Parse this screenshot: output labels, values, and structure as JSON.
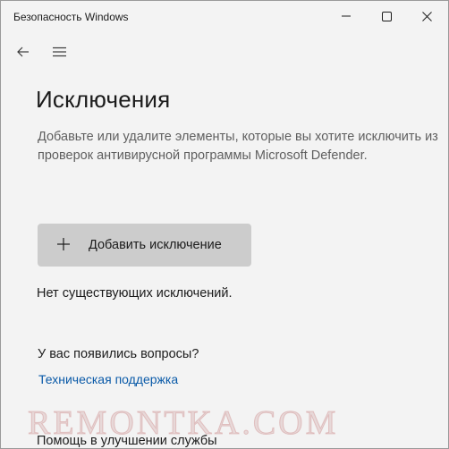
{
  "window": {
    "title": "Безопасность Windows"
  },
  "controls": {
    "minimize_icon": "minimize-icon",
    "maximize_icon": "maximize-icon",
    "close_icon": "close-icon"
  },
  "nav": {
    "back_icon": "arrow-left-icon",
    "menu_icon": "hamburger-menu-icon"
  },
  "page": {
    "title": "Исключения",
    "description_line1": "Добавьте или удалите элементы, которые вы хотите исключить из",
    "description_line2": "проверок антивирусной программы Microsoft Defender.",
    "add_button_label": "Добавить исключение",
    "empty_state": "Нет существующих исключений.",
    "questions_heading": "У вас появились вопросы?",
    "support_link": "Техническая поддержка",
    "improve_heading": "Помощь в улучшении службы"
  },
  "watermark": "REMONTKA.COM",
  "colors": {
    "background": "#f3f3f3",
    "button": "#cccccc",
    "link": "#0a5aa8",
    "secondary_text": "#5f5f5f"
  }
}
